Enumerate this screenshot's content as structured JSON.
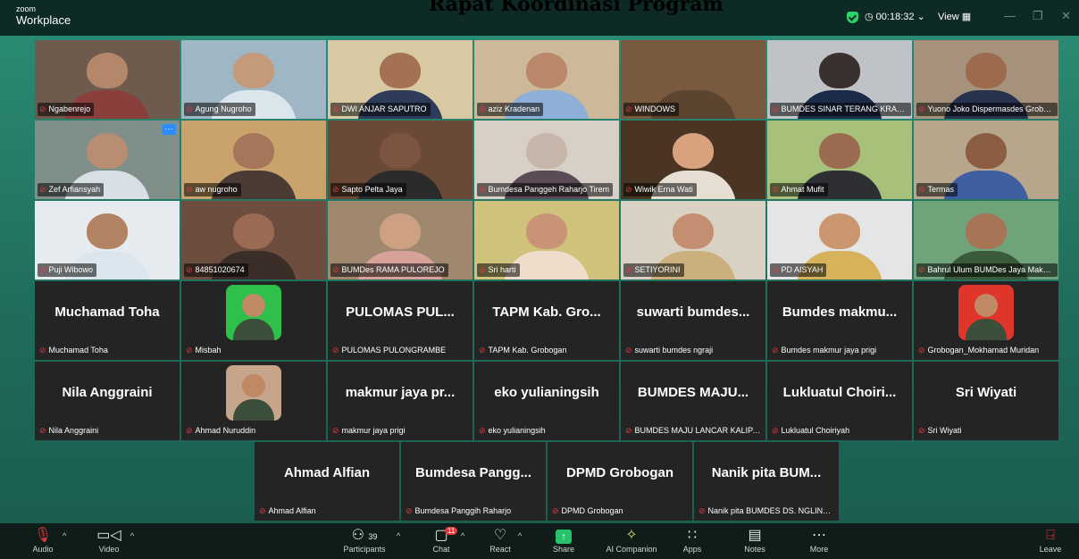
{
  "app": {
    "brand_small": "zoom",
    "brand_large": "Workplace"
  },
  "meeting": {
    "title": "Rapat Koordinasi Program"
  },
  "topbar": {
    "timer": "00:18:32",
    "view_label": "View"
  },
  "rows": [
    [
      {
        "name": "Ngabenrejo",
        "mode": "video",
        "bg": "#6f5a4e",
        "skin": "#b5876a",
        "shirt": "#8a3f3c"
      },
      {
        "name": "Agung Nugroho",
        "mode": "video",
        "bg": "#9fb6c4",
        "skin": "#c49a7a",
        "shirt": "#dbe5ec"
      },
      {
        "name": "DWI ANJAR SAPUTRO",
        "mode": "video",
        "bg": "#d8c9a3",
        "skin": "#a37252",
        "shirt": "#2f3b5a"
      },
      {
        "name": "aziz Kradenan",
        "mode": "video",
        "bg": "#cdb89a",
        "skin": "#b9876a",
        "shirt": "#8fb0d6"
      },
      {
        "name": "WINDOWS",
        "mode": "video",
        "bg": "#7a5a3e",
        "skin": "#7a5a3e",
        "shirt": "#5b4430"
      },
      {
        "name": "BUMDES SINAR TERANG KRANGGAN",
        "mode": "video",
        "bg": "#bfc3c7",
        "skin": "#3a3030",
        "shirt": "#1d2b4a"
      },
      {
        "name": "Yuono Joko Dispermasdes Grobogan",
        "mode": "video",
        "bg": "#a6927c",
        "skin": "#9c6b4e",
        "shirt": "#27324d",
        "speaker": true
      }
    ],
    [
      {
        "name": "Zef Arfiansyah",
        "mode": "video",
        "bg": "#7f8f8a",
        "skin": "#b88d72",
        "shirt": "#d8e0e6",
        "dots": true
      },
      {
        "name": "aw nugroho",
        "mode": "video",
        "bg": "#c9a36b",
        "skin": "#a5765a",
        "shirt": "#4a3b34"
      },
      {
        "name": "Sapto Pelta Jaya",
        "mode": "video",
        "bg": "#6a4a36",
        "skin": "#7b5442",
        "shirt": "#2b2b2b"
      },
      {
        "name": "Bumdesa Panggeh Raharjo Tirem",
        "mode": "video",
        "bg": "#d8cfc7",
        "skin": "#c7b6aa",
        "shirt": "#5a4b56"
      },
      {
        "name": "Wiwik Erna Wati",
        "mode": "video",
        "bg": "#4a3524",
        "skin": "#d8a27e",
        "shirt": "#e6ded3"
      },
      {
        "name": "Ahmat Mufit",
        "mode": "video",
        "bg": "#a7c07a",
        "skin": "#9b6c4f",
        "shirt": "#2d2f33"
      },
      {
        "name": "Termas",
        "mode": "video",
        "bg": "#b7a68c",
        "skin": "#8b5d43",
        "shirt": "#3f5fa0"
      }
    ],
    [
      {
        "name": "Puji Wibowo",
        "mode": "video",
        "bg": "#e6ebef",
        "skin": "#b28463",
        "shirt": "#dce6ee"
      },
      {
        "name": "84851020674",
        "mode": "video",
        "bg": "#6d4d3e",
        "skin": "#9a6b52",
        "shirt": "#3b2d28"
      },
      {
        "name": "BUMDes RAMA PULOREJO",
        "mode": "video",
        "bg": "#a0886f",
        "skin": "#cfa183",
        "shirt": "#d6a29a"
      },
      {
        "name": "Sri harti",
        "mode": "video",
        "bg": "#cfc27a",
        "skin": "#c99475",
        "shirt": "#f0dccb"
      },
      {
        "name": "SETIYORINI",
        "mode": "video",
        "bg": "#d9d2c4",
        "skin": "#c48f70",
        "shirt": "#c9b07c"
      },
      {
        "name": "PD AISYAH",
        "mode": "video",
        "bg": "#e5e5e5",
        "skin": "#c9966f",
        "shirt": "#d6b25a"
      },
      {
        "name": "Bahrul Ulum BUMDes Jaya Makmur",
        "mode": "video",
        "bg": "#6fa37a",
        "skin": "#a77455",
        "shirt": "#3b5a3a"
      }
    ],
    [
      {
        "name": "Muchamad Toha",
        "mode": "text",
        "display": "Muchamad Toha"
      },
      {
        "name": "Misbah",
        "mode": "avatar",
        "avatar_bg": "#2ec04a"
      },
      {
        "name": "PULOMAS PULONGRAMBE",
        "mode": "text",
        "display": "PULOMAS PUL..."
      },
      {
        "name": "TAPM Kab. Grobogan",
        "mode": "text",
        "display": "TAPM Kab. Gro..."
      },
      {
        "name": "suwarti bumdes ngraji",
        "mode": "text",
        "display": "suwarti bumdes..."
      },
      {
        "name": "Bumdes makmur jaya prigi",
        "mode": "text",
        "display": "Bumdes makmu..."
      },
      {
        "name": "Grobogan_Mokhamad Muridan",
        "mode": "avatar",
        "avatar_bg": "#e0352b"
      }
    ],
    [
      {
        "name": "Nila Anggraini",
        "mode": "text",
        "display": "Nila Anggraini"
      },
      {
        "name": "Ahmad Nuruddin",
        "mode": "avatar",
        "avatar_bg": "#c6a58a"
      },
      {
        "name": "makmur jaya prigi",
        "mode": "text",
        "display": "makmur jaya pr..."
      },
      {
        "name": "eko yulianingsih",
        "mode": "text",
        "display": "eko yulianingsih"
      },
      {
        "name": "BUMDES MAJU LANCAR KALIPANG",
        "mode": "text",
        "display": "BUMDES MAJU..."
      },
      {
        "name": "Lukluatul Choiriyah",
        "mode": "text",
        "display": "Lukluatul Choiri..."
      },
      {
        "name": "Sri Wiyati",
        "mode": "text",
        "display": "Sri Wiyati"
      }
    ],
    [
      {
        "name": "Ahmad Alfian",
        "mode": "text",
        "display": "Ahmad Alfian"
      },
      {
        "name": "Bumdesa Panggih Raharjo",
        "mode": "text",
        "display": "Bumdesa Pangg..."
      },
      {
        "name": "DPMD Grobogan",
        "mode": "text",
        "display": "DPMD Grobogan"
      },
      {
        "name": "Nanik pita BUMDES DS. NGLINDUK",
        "mode": "text",
        "display": "Nanik pita BUM..."
      }
    ]
  ],
  "toolbar": {
    "audio": "Audio",
    "video": "Video",
    "participants": "Participants",
    "participants_count": "39",
    "chat": "Chat",
    "chat_badge": "11",
    "react": "React",
    "share": "Share",
    "ai_companion": "AI Companion",
    "apps": "Apps",
    "notes": "Notes",
    "more": "More",
    "leave": "Leave"
  },
  "colors": {
    "stage": "#1f6b5a",
    "tile": "#242424",
    "speaker_outline": "#34c759",
    "mute": "#e0393e",
    "share": "#25c26a"
  }
}
